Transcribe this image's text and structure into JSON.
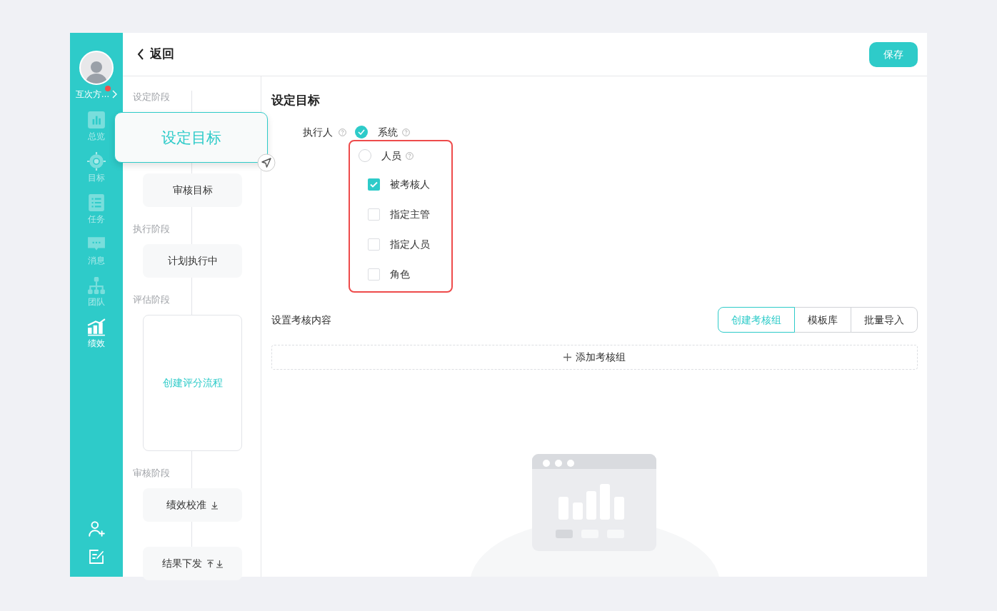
{
  "sidebar": {
    "user": {
      "name": "互次方…",
      "has_notification": true
    },
    "nav": [
      {
        "label": "总览",
        "selected": false
      },
      {
        "label": "目标",
        "selected": false
      },
      {
        "label": "任务",
        "selected": false
      },
      {
        "label": "消息",
        "selected": false
      },
      {
        "label": "团队",
        "selected": false
      },
      {
        "label": "绩效",
        "selected": true
      }
    ]
  },
  "header": {
    "back": "返回",
    "save": "保存"
  },
  "flow": [
    {
      "label": "设定阶段",
      "steps": [
        {
          "label": "设定目标",
          "kind": "focused"
        },
        {
          "label": "审核目标",
          "kind": "normal",
          "can_move_up": false,
          "can_move_down": false
        }
      ]
    },
    {
      "label": "执行阶段",
      "steps": [
        {
          "label": "计划执行中",
          "kind": "normal",
          "can_move_up": false,
          "can_move_down": false
        }
      ]
    },
    {
      "label": "评估阶段",
      "steps": [
        {
          "label": "创建评分流程",
          "kind": "large"
        }
      ]
    },
    {
      "label": "审核阶段",
      "steps": [
        {
          "label": "绩效校准",
          "kind": "normal",
          "can_move_up": false,
          "can_move_down": true
        },
        {
          "label": "结果下发",
          "kind": "normal",
          "can_move_up": true,
          "can_move_down": true
        }
      ]
    }
  ],
  "main": {
    "title": "设定目标",
    "executor": {
      "label": "执行人",
      "options": [
        {
          "label": "系统",
          "selected": true
        },
        {
          "label": "人员",
          "selected": false
        }
      ],
      "person_types": [
        {
          "label": "被考核人",
          "checked": true
        },
        {
          "label": "指定主管",
          "checked": false
        },
        {
          "label": "指定人员",
          "checked": false
        },
        {
          "label": "角色",
          "checked": false
        }
      ]
    },
    "content": {
      "label": "设置考核内容",
      "actions": [
        {
          "label": "创建考核组",
          "selected": true
        },
        {
          "label": "模板库",
          "selected": false
        },
        {
          "label": "批量导入",
          "selected": false
        }
      ],
      "add": "添加考核组"
    }
  }
}
